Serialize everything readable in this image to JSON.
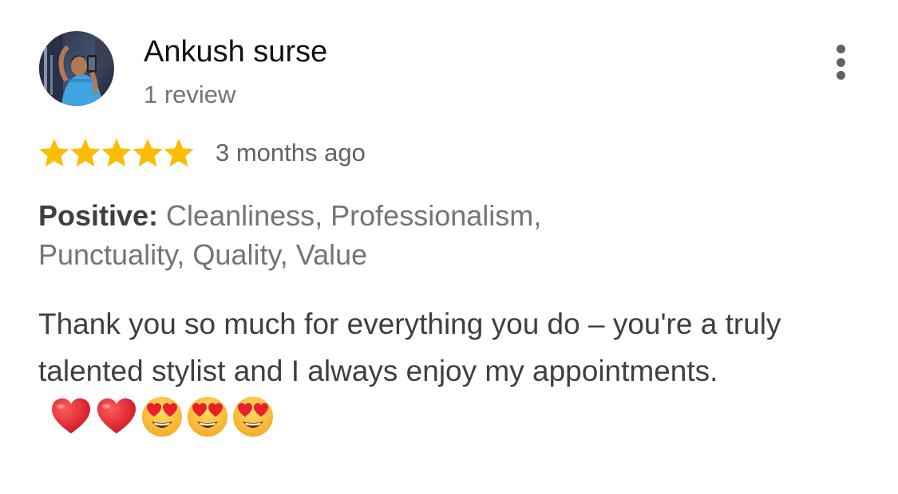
{
  "reviewer": {
    "name": "Ankush surse",
    "review_count": "1 review",
    "avatar_icon": "avatar-photo"
  },
  "rating": {
    "stars": 5,
    "max_stars": 5,
    "star_color": "#fbbc04",
    "date": "3 months ago"
  },
  "positive": {
    "label": "Positive:",
    "line1": " Cleanliness, Professionalism,",
    "line2": " Punctuality, Quality, Value"
  },
  "review": {
    "text": "Thank you so much for everything you do – you're a truly talented stylist and I always enjoy my appointments.",
    "emojis": [
      "red-heart-icon",
      "red-heart-icon",
      "heart-eyes-face-icon",
      "heart-eyes-face-icon",
      "heart-eyes-face-icon"
    ]
  },
  "menu": {
    "icon": "more-vertical-icon"
  }
}
